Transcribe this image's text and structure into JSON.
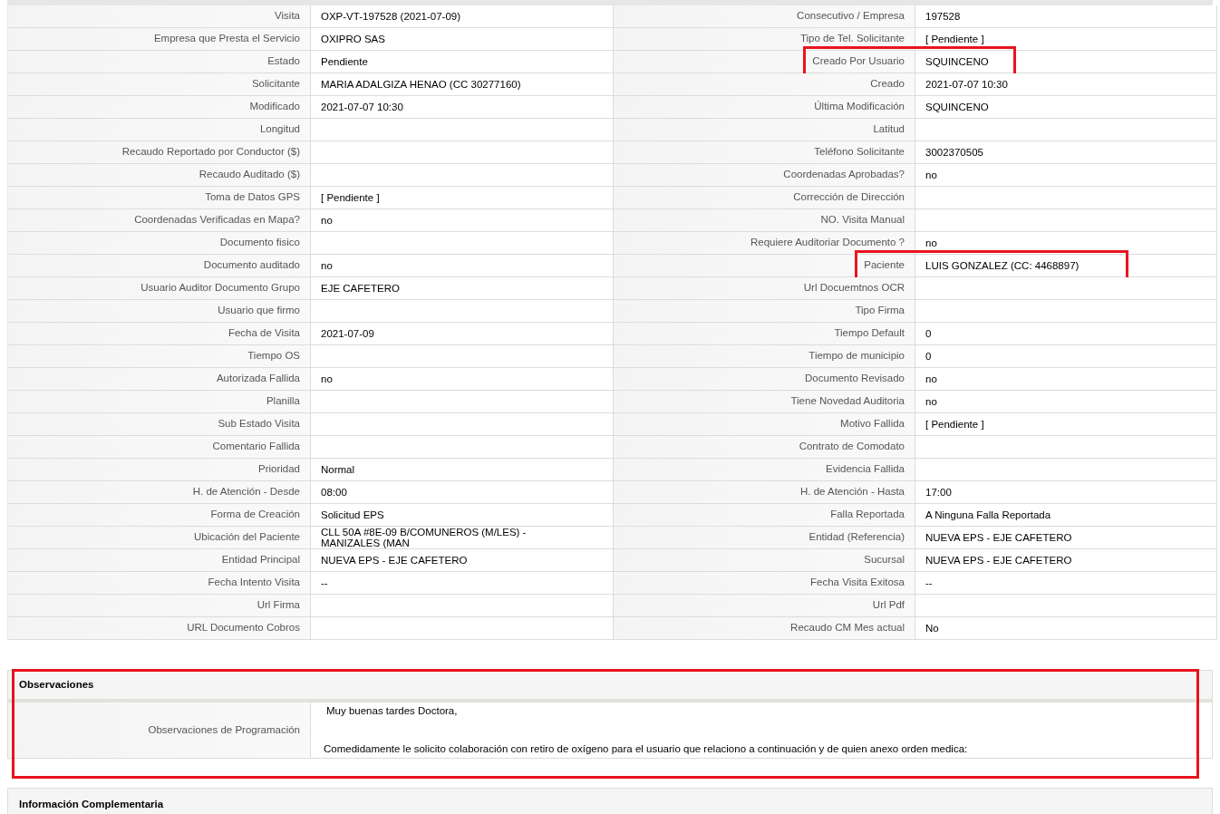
{
  "details": {
    "rows": [
      [
        {
          "label": "Visita",
          "value": "OXP-VT-197528 (2021-07-09)",
          "highlighted": false
        },
        {
          "label": "Consecutivo / Empresa",
          "value": "197528",
          "highlighted": false
        }
      ],
      [
        {
          "label": "Empresa que Presta el Servicio",
          "value": "OXIPRO SAS",
          "highlighted": false
        },
        {
          "label": "Tipo de Tel. Solicitante",
          "value": "[ Pendiente ]",
          "highlighted": false
        }
      ],
      [
        {
          "label": "Estado",
          "value": "Pendiente",
          "highlighted": false
        },
        {
          "label": "Creado Por Usuario",
          "value": "SQUINCENO",
          "highlighted": true
        }
      ],
      [
        {
          "label": "Solicitante",
          "value": "MARIA ADALGIZA HENAO (CC 30277160)",
          "highlighted": false
        },
        {
          "label": "Creado",
          "value": "2021-07-07 10:30",
          "highlighted": false
        }
      ],
      [
        {
          "label": "Modificado",
          "value": "2021-07-07 10:30",
          "highlighted": false
        },
        {
          "label": "Última Modificación",
          "value": "SQUINCENO",
          "highlighted": false
        }
      ],
      [
        {
          "label": "Longitud",
          "highlighted": false
        },
        {
          "label": "Latitud",
          "highlighted": false
        }
      ],
      [
        {
          "label": "Recaudo Reportado por Conductor ($)",
          "highlighted": false
        },
        {
          "label": "Teléfono Solicitante",
          "value": "3002370505",
          "highlighted": false
        }
      ],
      [
        {
          "label": "Recaudo Auditado ($)",
          "highlighted": false
        },
        {
          "label": "Coordenadas Aprobadas?",
          "value": "no",
          "highlighted": false
        }
      ],
      [
        {
          "label": "Toma de Datos GPS",
          "value": "[ Pendiente ]",
          "highlighted": false
        },
        {
          "label": "Corrección de Dirección",
          "highlighted": false
        }
      ],
      [
        {
          "label": "Coordenadas Verificadas en Mapa?",
          "value": "no",
          "highlighted": false
        },
        {
          "label": "NO. Visita Manual",
          "highlighted": false
        }
      ],
      [
        {
          "label": "Documento fisico",
          "highlighted": false
        },
        {
          "label": "Requiere Auditoriar Documento ?",
          "value": "no",
          "highlighted": false
        }
      ],
      [
        {
          "label": "Documento auditado",
          "value": "no",
          "highlighted": false
        },
        {
          "label": "Paciente",
          "value": "LUIS GONZALEZ (CC: 4468897)",
          "highlighted": true
        }
      ],
      [
        {
          "label": "Usuario Auditor Documento Grupo",
          "value": "EJE CAFETERO",
          "highlighted": false
        },
        {
          "label": "Url Docuemtnos OCR",
          "highlighted": false
        }
      ],
      [
        {
          "label": "Usuario que firmo",
          "highlighted": false
        },
        {
          "label": "Tipo Firma",
          "highlighted": false
        }
      ],
      [
        {
          "label": "Fecha de Visita",
          "value": "2021-07-09",
          "highlighted": false
        },
        {
          "label": "Tiempo Default",
          "value": "0",
          "highlighted": false
        }
      ],
      [
        {
          "label": "Tiempo OS",
          "highlighted": false
        },
        {
          "label": "Tiempo de municipio",
          "value": "0",
          "highlighted": false
        }
      ],
      [
        {
          "label": "Autorizada Fallida",
          "value": "no",
          "highlighted": false
        },
        {
          "label": "Documento Revisado",
          "value": "no",
          "highlighted": false
        }
      ],
      [
        {
          "label": "Planilla",
          "highlighted": false
        },
        {
          "label": "Tiene Novedad Auditoria",
          "value": "no",
          "highlighted": false
        }
      ],
      [
        {
          "label": "Sub Estado Visita",
          "highlighted": false
        },
        {
          "label": "Motivo Fallida",
          "value": "[ Pendiente ]",
          "highlighted": false
        }
      ],
      [
        {
          "label": "Comentario Fallida",
          "highlighted": false
        },
        {
          "label": "Contrato de Comodato",
          "highlighted": false
        }
      ],
      [
        {
          "label": "Prioridad",
          "value": "Normal",
          "highlighted": false
        },
        {
          "label": "Evidencia Fallida",
          "highlighted": false
        }
      ],
      [
        {
          "label": "H. de Atención - Desde",
          "value": "08:00",
          "highlighted": false
        },
        {
          "label": "H. de Atención - Hasta",
          "value": "17:00",
          "highlighted": false
        }
      ],
      [
        {
          "label": "Forma de Creación",
          "value": "Solicitud EPS",
          "highlighted": false
        },
        {
          "label": "Falla Reportada",
          "value": "A Ninguna Falla Reportada",
          "highlighted": false
        }
      ],
      [
        {
          "label": "Ubicación del Paciente",
          "value": "CLL 50A #8E-09 B/COMUNEROS (M/LES) - MANIZALES (MAN",
          "highlighted": false
        },
        {
          "label": "Entidad (Referencia)",
          "value": "NUEVA EPS - EJE CAFETERO",
          "highlighted": false
        }
      ],
      [
        {
          "label": "Entidad Principal",
          "value": "NUEVA EPS - EJE CAFETERO",
          "highlighted": false
        },
        {
          "label": "Sucursal",
          "value": "NUEVA EPS - EJE CAFETERO",
          "highlighted": false
        }
      ],
      [
        {
          "label": "Fecha Intento Visita",
          "value": "--",
          "highlighted": false
        },
        {
          "label": "Fecha Visita Exitosa",
          "value": "--",
          "highlighted": false
        }
      ],
      [
        {
          "label": "Url Firma",
          "highlighted": false
        },
        {
          "label": "Url Pdf",
          "highlighted": false
        }
      ],
      [
        {
          "label": "URL Documento Cobros",
          "highlighted": false
        },
        {
          "label": "Recaudo CM Mes actual",
          "value": "No",
          "highlighted": false
        }
      ]
    ]
  },
  "observaciones": {
    "title": "Observaciones",
    "highlighted": true,
    "label": "Observaciones de Programación",
    "paragraphs": [
      "Muy buenas tardes Doctora,",
      "Comedidamente le solicito colaboración con retiro de oxígeno para el usuario que relaciono a continuación y de quien anexo orden medica:"
    ]
  },
  "complementaria": {
    "title": "Información Complementaria"
  }
}
